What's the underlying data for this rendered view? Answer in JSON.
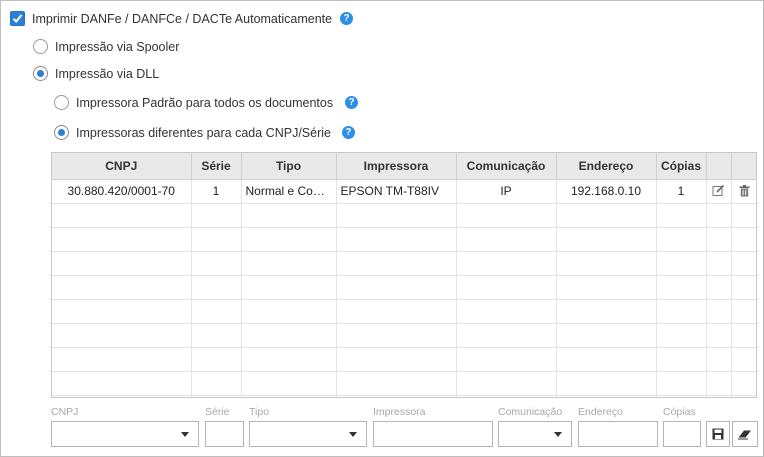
{
  "options": {
    "auto_print_label": "Imprimir DANFe / DANFCe / DACTe Automaticamente",
    "spooler_label": "Impressão via Spooler",
    "dll_label": "Impressão via DLL",
    "default_printer_label": "Impressora Padrão para todos os documentos",
    "per_cnpj_label": "Impressoras diferentes para cada CNPJ/Série",
    "help_glyph": "?"
  },
  "table": {
    "headers": [
      "CNPJ",
      "Série",
      "Tipo",
      "Impressora",
      "Comunicação",
      "Endereço",
      "Cópias"
    ],
    "rows": [
      {
        "cnpj": "30.880.420/0001-70",
        "serie": "1",
        "tipo": "Normal e Contingência",
        "impressora": "EPSON TM-T88IV",
        "comunicacao": "IP",
        "endereco": "192.168.0.10",
        "copias": "1"
      }
    ]
  },
  "form": {
    "labels": {
      "cnpj": "CNPJ",
      "serie": "Série",
      "tipo": "Tipo",
      "impressora": "Impressora",
      "comunicacao": "Comunicação",
      "endereco": "Endereço",
      "copias": "Cópias"
    }
  },
  "colors": {
    "accent": "#2b7fd6",
    "help": "#2b8ee8"
  }
}
